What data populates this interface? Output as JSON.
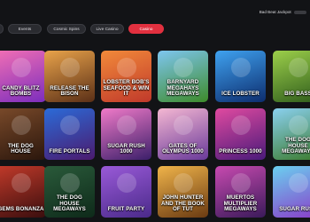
{
  "header": {
    "jackpot_label": "Bad Beat Jackpot"
  },
  "filters": [
    {
      "label": "",
      "active": false
    },
    {
      "label": "Events",
      "active": false
    },
    {
      "label": "Cosmic Spins",
      "active": false
    },
    {
      "label": "Live Casino",
      "active": false
    },
    {
      "label": "Casino",
      "active": true
    }
  ],
  "games": [
    {
      "title": "Candy Blitz Bombs",
      "bg": [
        "#f26fb4",
        "#7b2dbd"
      ]
    },
    {
      "title": "Release the Bison",
      "bg": [
        "#e9a34a",
        "#5a2f17"
      ]
    },
    {
      "title": "Lobster Bob's Seafood & Win It",
      "bg": [
        "#f28a3a",
        "#c0392b"
      ]
    },
    {
      "title": "Barnyard Megahays Megaways",
      "bg": [
        "#7ec6f0",
        "#3d8b2a"
      ]
    },
    {
      "title": "Ice Lobster",
      "bg": [
        "#3fa2f0",
        "#0d2d6e"
      ]
    },
    {
      "title": "Big Bass",
      "bg": [
        "#9ccf4a",
        "#2d5a1b"
      ]
    },
    {
      "title": "The Dog House",
      "bg": [
        "#7a4a2a",
        "#2a160c"
      ]
    },
    {
      "title": "Fire Portals",
      "bg": [
        "#2b6bd8",
        "#4b1a6e"
      ]
    },
    {
      "title": "Sugar Rush 1000",
      "bg": [
        "#f07ac8",
        "#3b1f6a"
      ]
    },
    {
      "title": "Gates of Olympus 1000",
      "bg": [
        "#f4b7d2",
        "#6a3a9a"
      ]
    },
    {
      "title": "Princess 1000",
      "bg": [
        "#e04aa0",
        "#4a1a7a"
      ]
    },
    {
      "title": "The Dog House Megaways",
      "bg": [
        "#8ad0f0",
        "#3a7a2a"
      ]
    },
    {
      "title": "Gems Bonanza",
      "bg": [
        "#c23a2a",
        "#3a0e0e"
      ]
    },
    {
      "title": "The Dog House Megaways",
      "bg": [
        "#2a5a3a",
        "#0e2a1a"
      ]
    },
    {
      "title": "Fruit Party",
      "bg": [
        "#9a5ad8",
        "#4a2a8a"
      ]
    },
    {
      "title": "John Hunter and the Book of Tut",
      "bg": [
        "#f0b44a",
        "#6a3a12"
      ]
    },
    {
      "title": "Muertos Multiplier Megaways",
      "bg": [
        "#c84ab0",
        "#3a1a5a"
      ]
    },
    {
      "title": "Sugar Rush",
      "bg": [
        "#6ad0f0",
        "#8a3ac8"
      ]
    }
  ]
}
